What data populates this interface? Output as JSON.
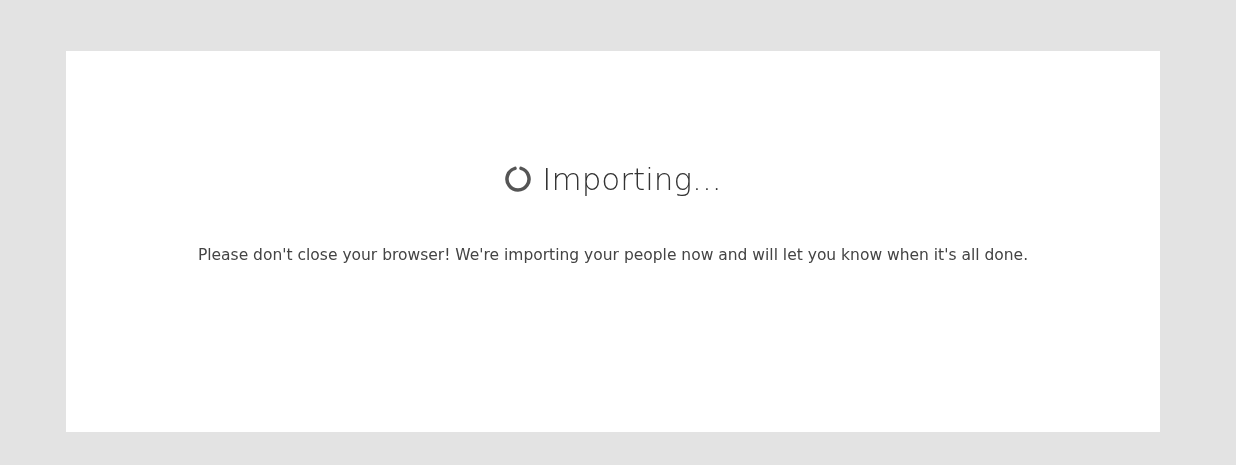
{
  "dialog": {
    "title": "Importing...",
    "message": "Please don't close your browser! We're importing your people now and will let you know when it's all done."
  }
}
